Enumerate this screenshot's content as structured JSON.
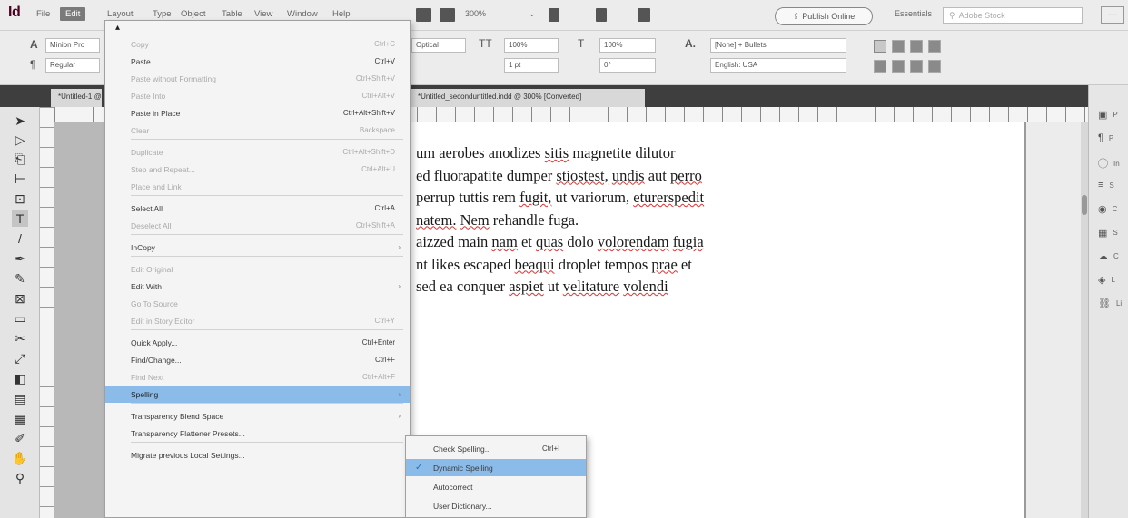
{
  "app": {
    "logo": "Id"
  },
  "menubar": {
    "items": [
      "File",
      "Edit",
      "Layout",
      "Type",
      "Object",
      "Table",
      "View",
      "Window",
      "Help"
    ],
    "zoom": "300%",
    "publish_label": "Publish Online",
    "workspace": "Essentials",
    "search_placeholder": "Adobe Stock"
  },
  "control": {
    "font_family": "Minion Pro",
    "font_style": "Regular",
    "tracking": "Optical",
    "scale_h": "100%",
    "scale_v": "100%",
    "leading": "1 pt",
    "skew": "0°",
    "language_style": "[None] + Bullets",
    "language": "English: USA",
    "letter_a": "A"
  },
  "document": {
    "tab_title": "*Untitled-1 @ 300%",
    "tab_title_2": "*Untitled_seconduntitled.indd @ 300% [Converted]"
  },
  "page_text": {
    "lines": [
      "um aerobes anodizes sitis magnetite dilutor",
      "ed fluorapatite dumper stiostest, undis aut perro",
      "perrup tuttis rem fugit, ut variorum, eturerspedit",
      "natem. Nem rehandle fuga.",
      "aizzed main nam et quas dolo volorendam fugia",
      "nt likes escaped beaqui droplet tempos prae et",
      "sed ea conquer aspiet ut velitature volendi"
    ]
  },
  "right_panel": {
    "items": [
      {
        "icon": "pages-icon",
        "label": "P"
      },
      {
        "icon": "paragraph-icon",
        "label": "P"
      },
      {
        "icon": "info-icon",
        "label": "In"
      },
      {
        "icon": "stroke-icon",
        "label": "S"
      },
      {
        "icon": "color-icon",
        "label": "C"
      },
      {
        "icon": "swatches-icon",
        "label": "S"
      },
      {
        "icon": "cc-libraries-icon",
        "label": "C"
      },
      {
        "icon": "layers-icon",
        "label": "L"
      },
      {
        "icon": "links-icon",
        "label": "Li"
      }
    ]
  },
  "edit_menu": {
    "items": [
      {
        "label": "Copy",
        "shortcut": "Ctrl+C",
        "disabled": true
      },
      {
        "label": "Paste",
        "shortcut": "Ctrl+V",
        "disabled": false
      },
      {
        "label": "Paste without Formatting",
        "shortcut": "Ctrl+Shift+V",
        "disabled": true
      },
      {
        "label": "Paste Into",
        "shortcut": "Ctrl+Alt+V",
        "disabled": true
      },
      {
        "label": "Paste in Place",
        "shortcut": "Ctrl+Alt+Shift+V",
        "disabled": false
      },
      {
        "label": "Clear",
        "shortcut": "Backspace",
        "disabled": true
      },
      {
        "label": "Duplicate",
        "shortcut": "Ctrl+Alt+Shift+D",
        "disabled": true
      },
      {
        "label": "Step and Repeat...",
        "shortcut": "Ctrl+Alt+U",
        "disabled": true
      },
      {
        "label": "Place and Link",
        "shortcut": "",
        "disabled": true
      },
      {
        "label": "Select All",
        "shortcut": "Ctrl+A",
        "disabled": false
      },
      {
        "label": "Deselect All",
        "shortcut": "Ctrl+Shift+A",
        "disabled": true
      },
      {
        "label": "InCopy",
        "shortcut": "",
        "disabled": false
      },
      {
        "label": "Edit Original",
        "shortcut": "",
        "disabled": true
      },
      {
        "label": "Edit With",
        "shortcut": "",
        "disabled": false
      },
      {
        "label": "Go To Source",
        "shortcut": "",
        "disabled": true
      },
      {
        "label": "Edit in Story Editor",
        "shortcut": "Ctrl+Y",
        "disabled": true
      },
      {
        "label": "Quick Apply...",
        "shortcut": "Ctrl+Enter",
        "disabled": false
      },
      {
        "label": "Find/Change...",
        "shortcut": "Ctrl+F",
        "disabled": false
      },
      {
        "label": "Find Next",
        "shortcut": "Ctrl+Alt+F",
        "disabled": true
      },
      {
        "label": "Spelling",
        "shortcut": "",
        "disabled": false
      },
      {
        "label": "Transparency Blend Space",
        "shortcut": "",
        "disabled": false
      },
      {
        "label": "Transparency Flattener Presets...",
        "shortcut": "",
        "disabled": false
      },
      {
        "label": "Migrate previous Local Settings...",
        "shortcut": "",
        "disabled": false
      }
    ]
  },
  "spelling_submenu": {
    "items": [
      {
        "label": "Check Spelling...",
        "shortcut": "Ctrl+I"
      },
      {
        "label": "Dynamic Spelling",
        "shortcut": ""
      },
      {
        "label": "Autocorrect",
        "shortcut": ""
      },
      {
        "label": "User Dictionary...",
        "shortcut": ""
      }
    ]
  },
  "colors": {
    "highlight": "#8bbbe8",
    "logo": "#49021f",
    "spell_underline": "#e03030"
  }
}
